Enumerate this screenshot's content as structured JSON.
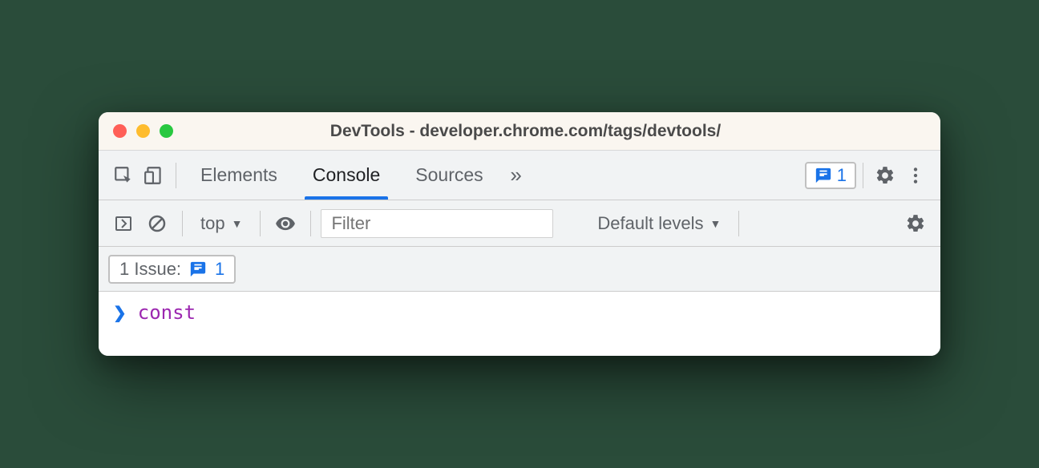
{
  "window": {
    "title": "DevTools - developer.chrome.com/tags/devtools/"
  },
  "tabs": {
    "elements": "Elements",
    "console": "Console",
    "sources": "Sources"
  },
  "badge": {
    "count": "1"
  },
  "toolbar": {
    "context": "top",
    "filter_placeholder": "Filter",
    "levels": "Default levels"
  },
  "issues": {
    "label": "1 Issue:",
    "count": "1"
  },
  "console": {
    "input": "const"
  }
}
